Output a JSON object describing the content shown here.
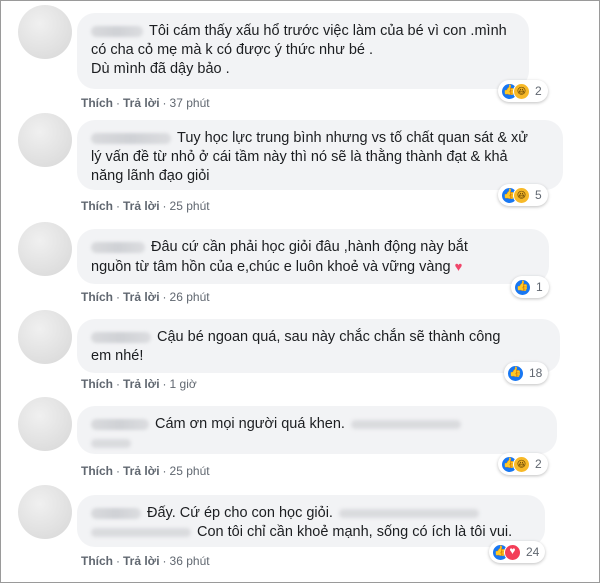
{
  "comments": [
    {
      "lines": [
        "Tôi cám thấy xấu hổ trước việc làm của bé vì con .mình",
        "có cha cỏ mẹ mà k có được ý thức như bé .",
        "Dù mình đã dậy bảo ."
      ],
      "like": "Thích",
      "reply": "Trả lời",
      "time": "37 phút",
      "reactions": [
        "like-icon",
        "haha-icon"
      ],
      "count": "2"
    },
    {
      "lines": [
        "Tuy học lực trung bình nhưng vs tố chất quan sát & xử",
        "lý vấn đề từ nhỏ ở cái tầm này thì nó sẽ là thằng thành đạt & khả",
        "năng lãnh đạo giỏi"
      ],
      "like": "Thích",
      "reply": "Trả lời",
      "time": "25 phút",
      "reactions": [
        "like-icon",
        "haha-icon"
      ],
      "count": "5"
    },
    {
      "lines": [
        "Đâu cứ cần phải học giỏi đâu ,hành động này bắt",
        "nguồn từ tâm hồn của e,chúc e luôn khoẻ và vững vàng"
      ],
      "like": "Thích",
      "reply": "Trả lời",
      "time": "26 phút",
      "reactions": [
        "like-icon"
      ],
      "count": "1"
    },
    {
      "lines": [
        "Cậu bé ngoan quá, sau này chắc chắn sẽ thành công",
        "em nhé!"
      ],
      "like": "Thích",
      "reply": "Trả lời",
      "time": "1 giờ",
      "reactions": [
        "like-icon"
      ],
      "count": "18"
    },
    {
      "lines": [
        "Cám ơn mọi người quá khen."
      ],
      "like": "Thích",
      "reply": "Trả lời",
      "time": "25 phút",
      "reactions": [
        "like-icon",
        "haha-icon"
      ],
      "count": "2"
    },
    {
      "lines": [
        "Đấy. Cứ ép cho con học giỏi.",
        "Con tôi chỉ cần khoẻ mạnh, sống có ích là tôi vui."
      ],
      "like": "Thích",
      "reply": "Trả lời",
      "time": "36 phút",
      "reactions": [
        "like-icon",
        "love-icon"
      ],
      "count": "24"
    }
  ],
  "colors": {
    "bubble": "#f2f3f5",
    "like": "#1877f2",
    "haha": "#f7b928",
    "love": "#f33e58",
    "meta_text": "#606770"
  }
}
